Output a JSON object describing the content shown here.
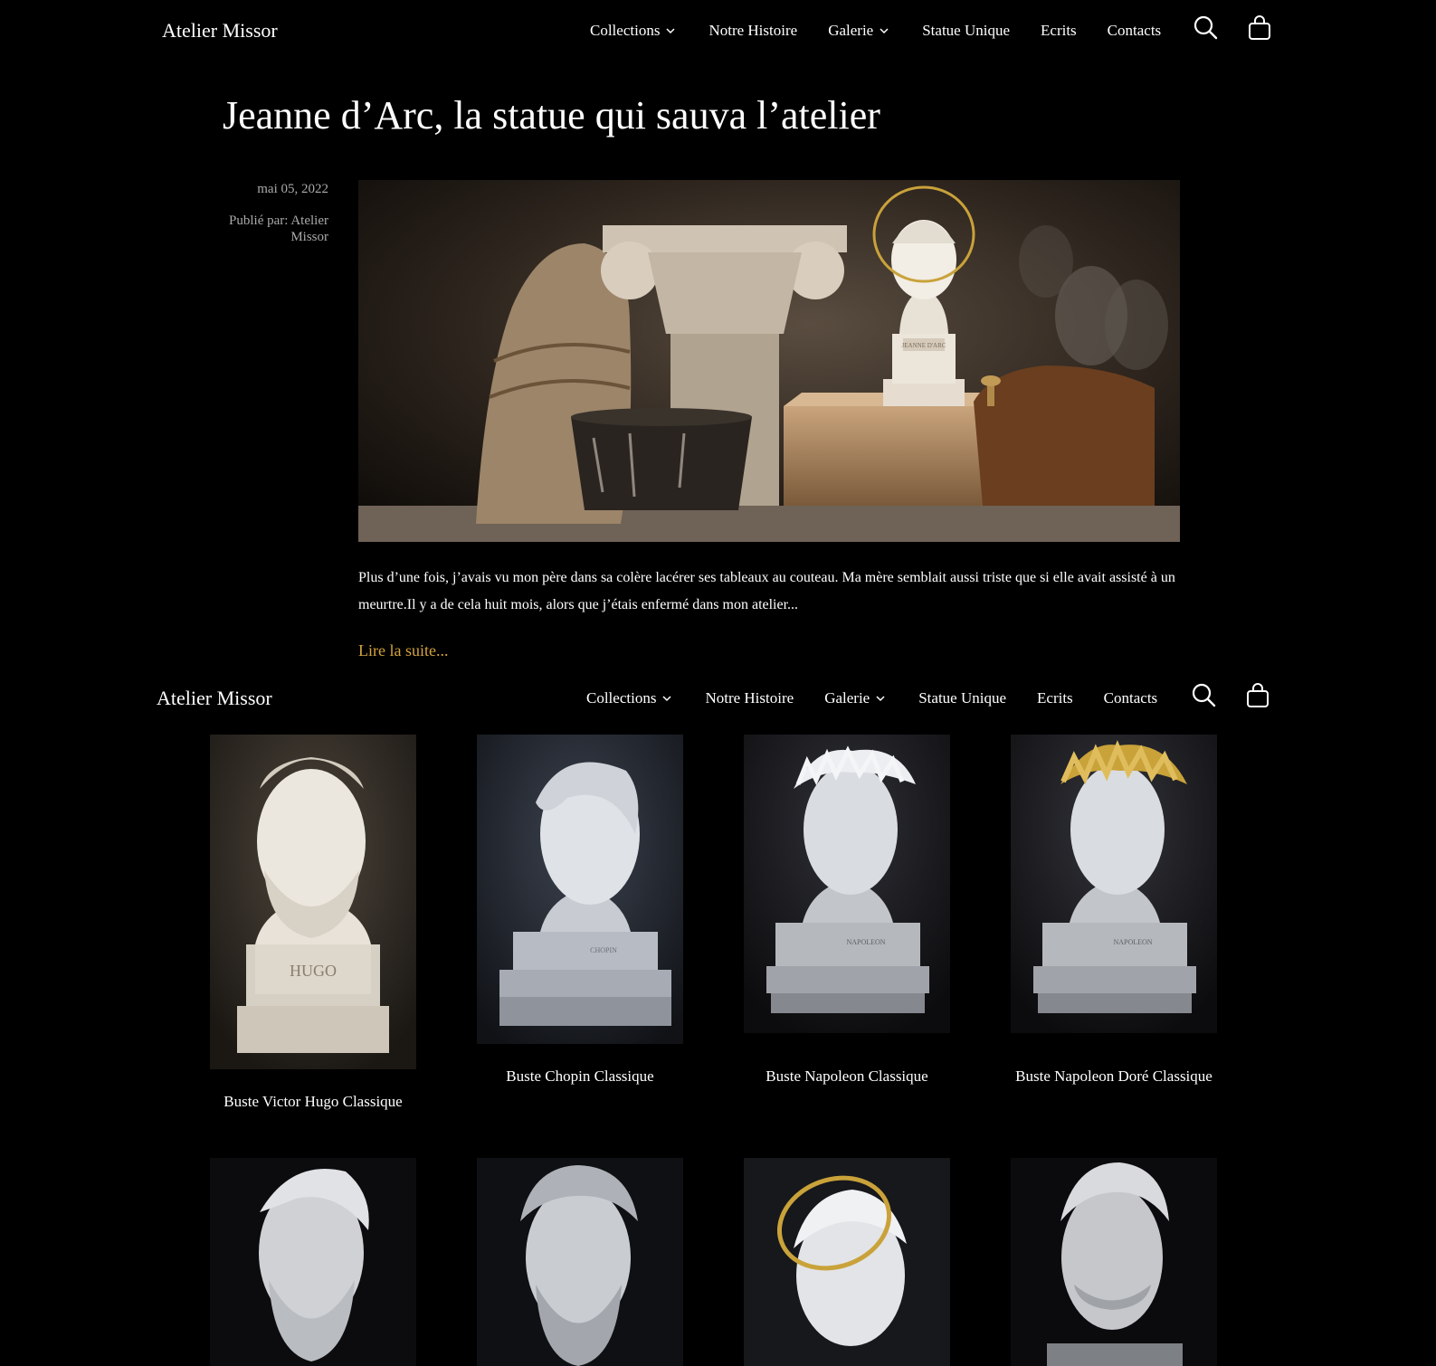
{
  "header": {
    "logo": "Atelier Missor",
    "nav": [
      {
        "label": "Collections",
        "has_dropdown": true
      },
      {
        "label": "Notre Histoire",
        "has_dropdown": false
      },
      {
        "label": "Galerie",
        "has_dropdown": true
      },
      {
        "label": "Statue Unique",
        "has_dropdown": false
      },
      {
        "label": "Ecrits",
        "has_dropdown": false
      },
      {
        "label": "Contacts",
        "has_dropdown": false
      }
    ],
    "icons": [
      "search-icon",
      "shopping-bag-icon"
    ]
  },
  "article": {
    "title": "Jeanne d’Arc, la statue qui sauva l’atelier",
    "date": "mai 05, 2022",
    "author": "Publié par: Atelier Missor",
    "excerpt": "Plus d’une fois, j’avais vu mon père dans sa colère lacérer ses tableaux au couteau. Ma mère semblait aussi triste que si elle avait assisté à un meurtre.Il y a de cela huit mois, alors que j’étais enfermé dans mon atelier...",
    "read_more": "Lire la suite...",
    "hero_plaque": "JEANNE D'ARC"
  },
  "products": [
    {
      "name": "Buste Victor Hugo Classique",
      "plaque": "HUGO"
    },
    {
      "name": "Buste Chopin Classique",
      "plaque": "CHOPIN"
    },
    {
      "name": "Buste Napoleon Classique",
      "plaque": "NAPOLEON"
    },
    {
      "name": "Buste Napoleon Doré Classique",
      "plaque": "NAPOLEON"
    },
    {
      "name": "",
      "plaque": ""
    },
    {
      "name": "",
      "plaque": ""
    },
    {
      "name": "",
      "plaque": ""
    },
    {
      "name": "",
      "plaque": ""
    }
  ],
  "colors": {
    "background": "#000000",
    "text": "#ffffff",
    "meta_text": "#aaaaaa",
    "accent_link": "#d4a43c",
    "gold": "#c9a23a"
  }
}
